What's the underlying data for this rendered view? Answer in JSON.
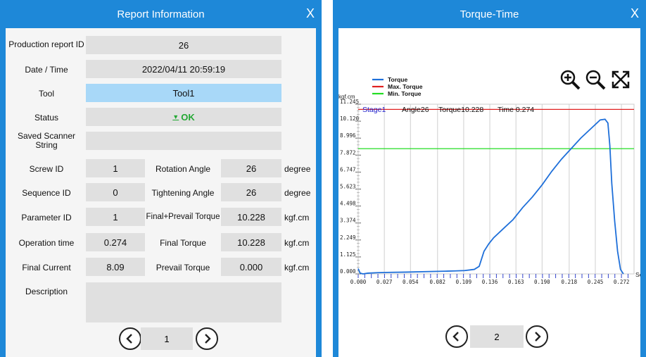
{
  "left": {
    "title": "Report Information",
    "close": "X",
    "fields": {
      "report_id": {
        "label": "Production report ID",
        "value": "26"
      },
      "datetime": {
        "label": "Date / Time",
        "value": "2022/04/11 20:59:19"
      },
      "tool": {
        "label": "Tool",
        "value": "Tool1"
      },
      "status": {
        "label": "Status",
        "value": "OK",
        "marker": "▼"
      },
      "scanner": {
        "label": "Saved Scanner String",
        "value": ""
      }
    },
    "grid": {
      "screw_id": {
        "label": "Screw ID",
        "value": "1"
      },
      "sequence_id": {
        "label": "Sequence ID",
        "value": "0"
      },
      "parameter_id": {
        "label": "Parameter ID",
        "value": "1"
      },
      "operation_time": {
        "label": "Operation time",
        "value": "0.274"
      },
      "final_current": {
        "label": "Final Current",
        "value": "8.09"
      },
      "rotation_angle": {
        "label": "Rotation Angle",
        "value": "26",
        "unit": "degree"
      },
      "tightening_angle": {
        "label": "Tightening Angle",
        "value": "26",
        "unit": "degree"
      },
      "final_prevail_torque": {
        "label": "Final+Prevail Torque",
        "value": "10.228",
        "unit": "kgf.cm"
      },
      "final_torque": {
        "label": "Final Torque",
        "value": "10.228",
        "unit": "kgf.cm"
      },
      "prevail_torque": {
        "label": "Prevail Torque",
        "value": "0.000",
        "unit": "kgf.cm"
      }
    },
    "description": {
      "label": "Description",
      "value": ""
    },
    "page": "1"
  },
  "right": {
    "title": "Torque-Time",
    "close": "X",
    "page": "2"
  },
  "chart_data": {
    "type": "line",
    "title": "",
    "ylabel": "kgf.cm",
    "xlabel": "Sec",
    "xlim": [
      0,
      0.285
    ],
    "ylim": [
      0,
      11.245
    ],
    "x_ticks": [
      "0.000",
      "0.027",
      "0.054",
      "0.082",
      "0.109",
      "0.136",
      "0.163",
      "0.190",
      "0.218",
      "0.245",
      "0.272"
    ],
    "y_ticks": [
      "0.000",
      "1.125",
      "2.249",
      "3.374",
      "4.498",
      "5.623",
      "6.747",
      "7.872",
      "8.996",
      "10.120",
      "11.245"
    ],
    "legend": [
      {
        "name": "Torque",
        "color": "#1e6fd9"
      },
      {
        "name": "Max. Torque",
        "color": "#e02020"
      },
      {
        "name": "Min. Torque",
        "color": "#22dd22"
      }
    ],
    "legend_placement": "top-left",
    "annotation": {
      "stage": "Stage1",
      "angle": "Angle26",
      "torque": "Torque10.228",
      "time": "Time  0.274"
    },
    "max_torque": 10.9,
    "min_torque": 8.3,
    "series": [
      {
        "name": "Torque",
        "x": [
          0.0,
          0.002,
          0.005,
          0.01,
          0.02,
          0.03,
          0.05,
          0.07,
          0.09,
          0.1,
          0.11,
          0.12,
          0.125,
          0.128,
          0.13,
          0.135,
          0.14,
          0.15,
          0.16,
          0.17,
          0.18,
          0.19,
          0.2,
          0.21,
          0.22,
          0.23,
          0.24,
          0.25,
          0.255,
          0.258,
          0.26,
          0.262,
          0.265,
          0.268,
          0.271,
          0.274
        ],
        "y": [
          0.35,
          0.05,
          0.0,
          0.05,
          0.08,
          0.1,
          0.12,
          0.15,
          0.18,
          0.2,
          0.22,
          0.3,
          0.5,
          1.1,
          1.5,
          2.0,
          2.4,
          3.0,
          3.6,
          4.4,
          5.1,
          5.9,
          6.8,
          7.6,
          8.3,
          9.0,
          9.6,
          10.2,
          10.25,
          10.0,
          8.5,
          6.0,
          3.5,
          1.5,
          0.3,
          0.0
        ]
      }
    ]
  }
}
